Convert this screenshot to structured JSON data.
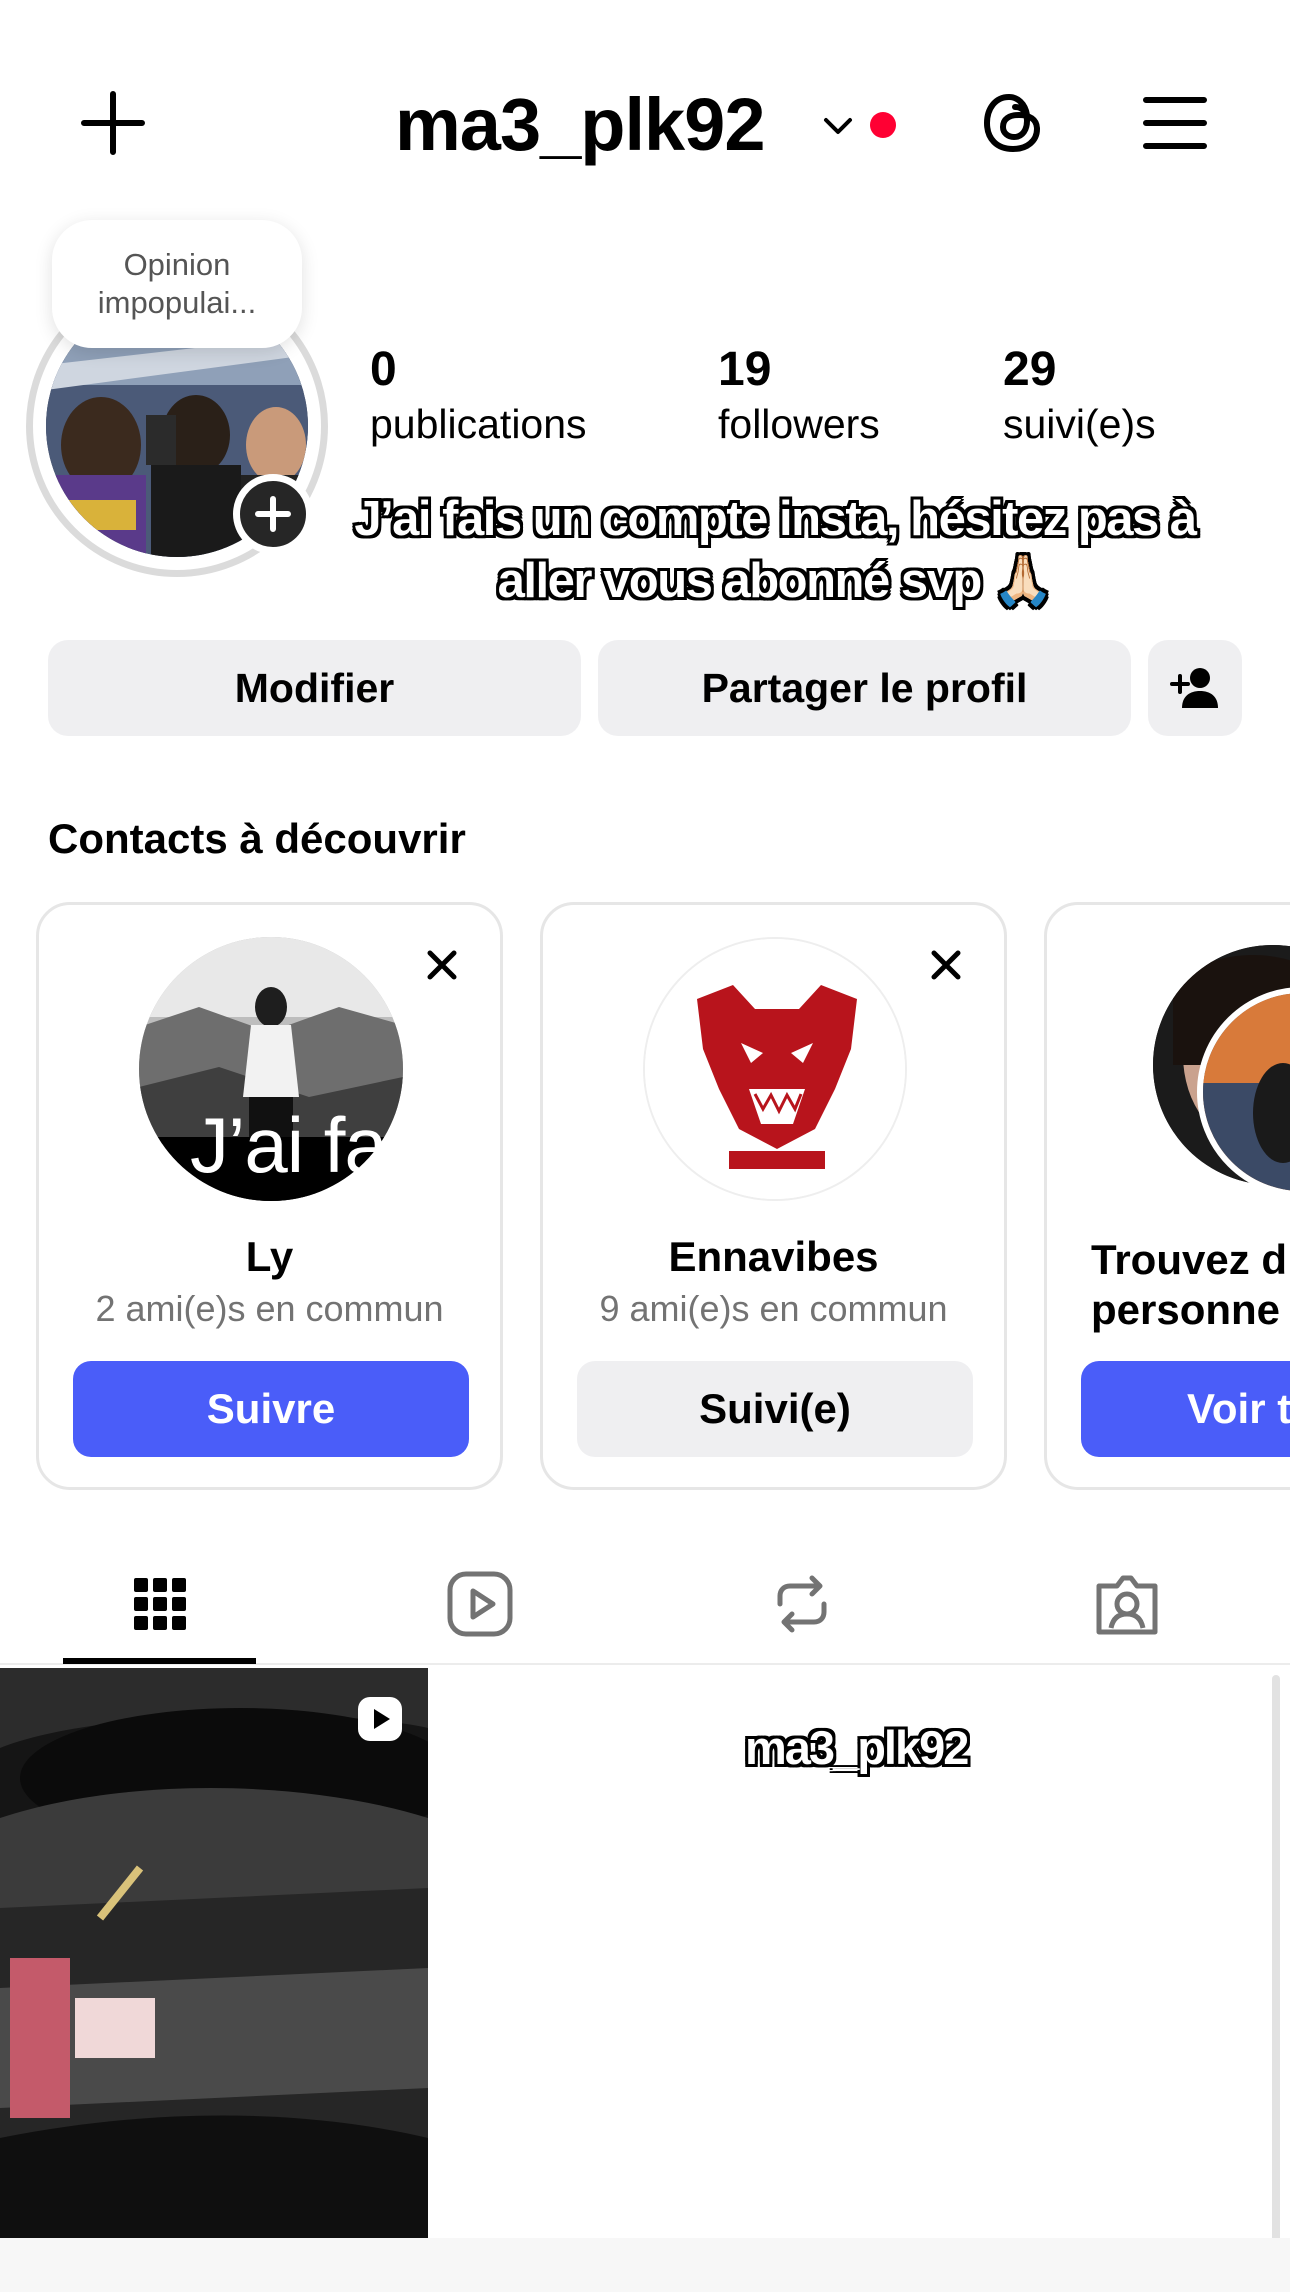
{
  "header": {
    "username": "ma3_plk92",
    "icons": [
      "plus-icon",
      "chevron-down-icon",
      "notification-dot",
      "threads-icon",
      "hamburger-menu-icon"
    ],
    "accent_dot_color": "#ff0033"
  },
  "profile": {
    "note_line1": "Opinion",
    "note_line2": "impopulai...",
    "stats": {
      "posts_count": "0",
      "posts_label": "publications",
      "followers_count": "19",
      "followers_label": "followers",
      "following_count": "29",
      "following_label": "suivi(e)s"
    },
    "caption": "J’ai fais un compte insta, hésitez pas à aller vous abonné svp 🙏🏻"
  },
  "actions": {
    "edit_label": "Modifier",
    "share_label": "Partager le profil"
  },
  "suggestions": {
    "title": "Contacts à découvrir",
    "cards": [
      {
        "name": "Ly",
        "mutual": "2 ami(e)s en commun",
        "button": "Suivre"
      },
      {
        "name": "Ennavibes",
        "mutual": "9 ami(e)s en commun",
        "button": "Suivi(e)"
      }
    ],
    "partial_card": {
      "text_line1": "Trouvez d",
      "text_line2": "personne",
      "button": "Voir t"
    },
    "overlay_text": "J’ai fa"
  },
  "tabs": [
    "grid-icon",
    "reels-icon",
    "reposts-icon",
    "tagged-icon"
  ],
  "grid": {
    "caption": "ma3_plk92"
  },
  "colors": {
    "primary_blue": "#4a5df9",
    "button_gray": "#efeff1",
    "muted_text": "#737373"
  }
}
